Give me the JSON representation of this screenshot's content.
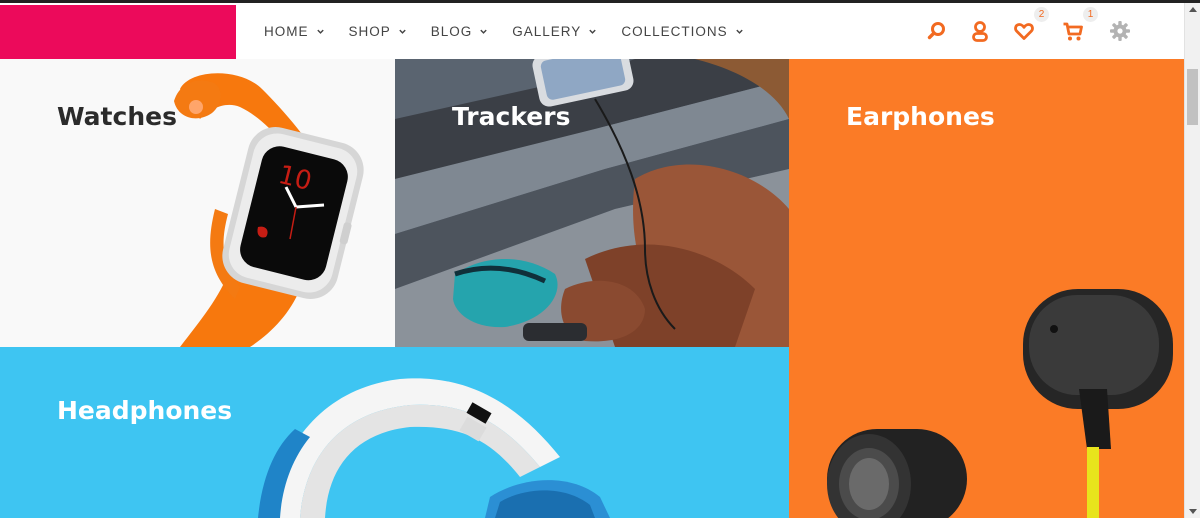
{
  "header": {
    "nav": [
      {
        "label": "HOME"
      },
      {
        "label": "SHOP"
      },
      {
        "label": "BLOG"
      },
      {
        "label": "GALLERY"
      },
      {
        "label": "COLLECTIONS"
      }
    ],
    "icons": {
      "search": "search-icon",
      "account": "user-icon",
      "wishlist": "heart-icon",
      "cart": "cart-icon",
      "settings": "gear-icon"
    },
    "wishlist_count": "2",
    "cart_count": "1",
    "accent_color": "#f26a21",
    "logo_color": "#ec0a5b"
  },
  "categories": {
    "watches": "Watches",
    "trackers": "Trackers",
    "earphones": "Earphones",
    "headphones": "Headphones"
  },
  "colors": {
    "earphones_bg": "#fb7b26",
    "headphones_bg": "#3ec5f2"
  }
}
